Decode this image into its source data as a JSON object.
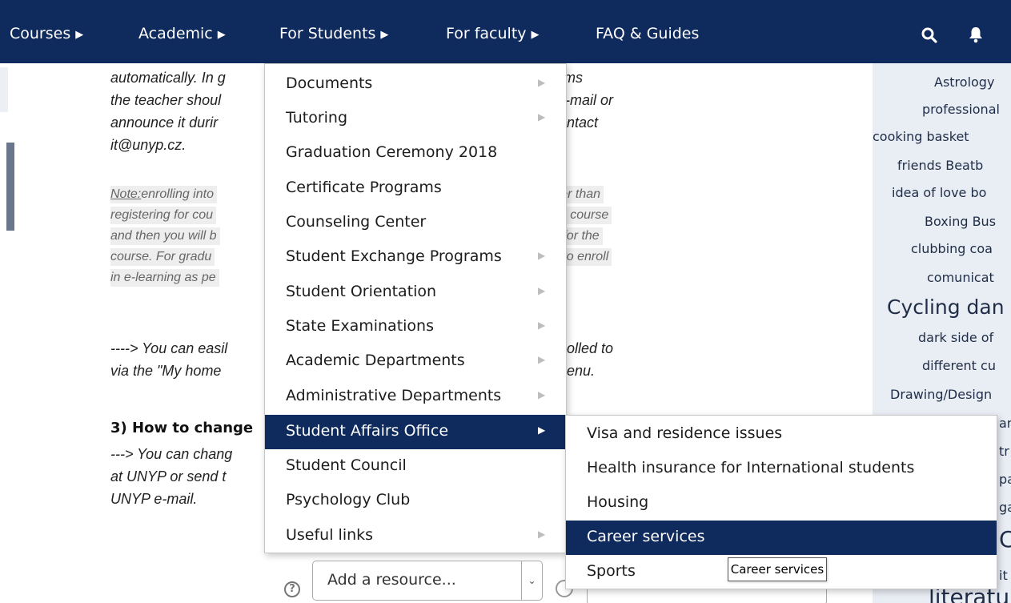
{
  "nav": {
    "items": [
      {
        "label": "Courses"
      },
      {
        "label": "Academic"
      },
      {
        "label": "For Students"
      },
      {
        "label": "For faculty"
      }
    ],
    "faq_label": "FAQ & Guides",
    "icons": {
      "search": "search-icon",
      "notifications": "bell-icon"
    }
  },
  "article": {
    "paragraph1": [
      "automatically. In g",
      "the teacher shoul",
      "announce it durir",
      "it@unyp.cz."
    ],
    "paragraph1_tail": [
      "grams",
      "-mail or",
      "ntact"
    ],
    "note_label": "Note:",
    "note_lines": [
      "enrolling into",
      "registering for cou",
      "and then you will b",
      "course. For gradu",
      "in e-learning as pe"
    ],
    "note_tail": [
      "other than",
      "he course",
      "g for the",
      "d to enroll"
    ],
    "paragraph2": [
      "----> You can easil",
      "via the \"My home"
    ],
    "paragraph2_tail": [
      "olled to",
      "enu."
    ],
    "heading3": "3) How to change",
    "paragraph3": [
      "---> You can chang",
      "at UNYP or send t",
      "UNYP e-mail."
    ]
  },
  "sidebar": {
    "tags": [
      "Astrology",
      "professional",
      "cooking  basket",
      "friends  Beatb",
      "idea of love  bo",
      "Boxing  Bus",
      "clubbing  coa",
      "comunicat",
      "Cycling  dan",
      "dark side of",
      "different cu",
      "Drawing/Design",
      "an",
      "tr",
      "pa",
      "ga",
      "C",
      "it",
      "literatu"
    ]
  },
  "resource": {
    "select_value": "Add a resource...",
    "help_symbol": "?"
  },
  "menu": {
    "items": [
      {
        "label": "Documents",
        "has_sub": true
      },
      {
        "label": "Tutoring",
        "has_sub": true
      },
      {
        "label": "Graduation Ceremony 2018",
        "has_sub": false
      },
      {
        "label": "Certificate Programs",
        "has_sub": false
      },
      {
        "label": "Counseling Center",
        "has_sub": false
      },
      {
        "label": "Student Exchange Programs",
        "has_sub": true
      },
      {
        "label": "Student Orientation",
        "has_sub": true
      },
      {
        "label": "State Examinations",
        "has_sub": true
      },
      {
        "label": "Academic Departments",
        "has_sub": true
      },
      {
        "label": "Administrative Departments",
        "has_sub": true
      },
      {
        "label": "Student Affairs Office",
        "has_sub": true,
        "active": true
      },
      {
        "label": "Student Council",
        "has_sub": false
      },
      {
        "label": "Psychology Club",
        "has_sub": false
      },
      {
        "label": "Useful links",
        "has_sub": true
      }
    ]
  },
  "submenu": {
    "items": [
      {
        "label": "Visa and residence issues"
      },
      {
        "label": "Health insurance for International students"
      },
      {
        "label": "Housing"
      },
      {
        "label": "Career services",
        "hovered": true
      },
      {
        "label": "Sports"
      }
    ]
  },
  "tooltip": {
    "text": "Career services"
  },
  "colors": {
    "navbar": "#0f2a5c",
    "active_item": "#0f2a5c",
    "sidebar": "#e9edf4"
  }
}
